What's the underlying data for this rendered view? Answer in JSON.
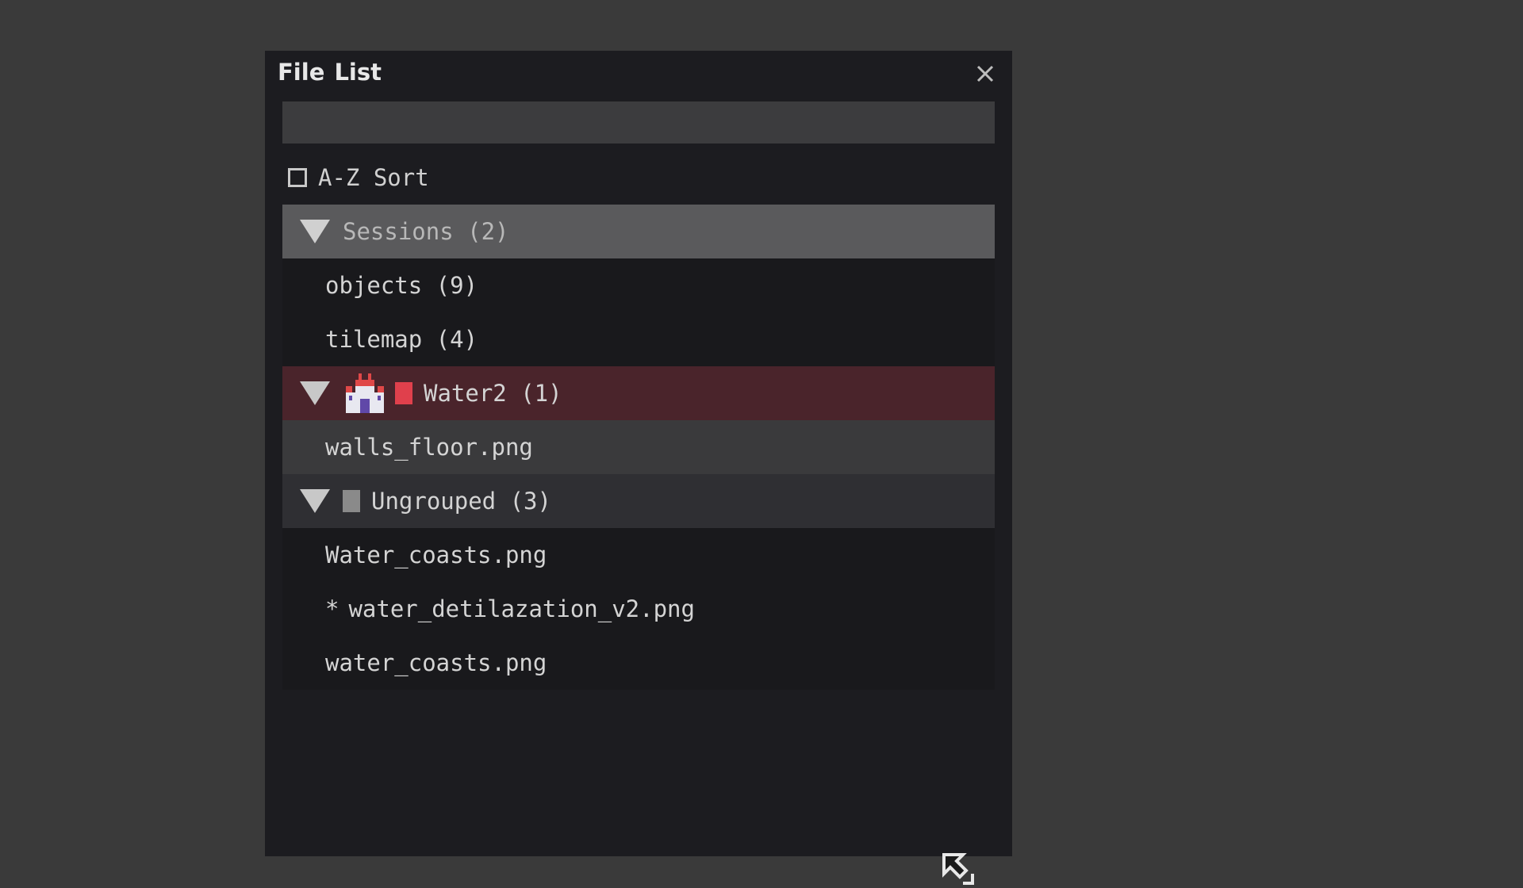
{
  "panel": {
    "title": "File List",
    "search": {
      "value": "",
      "placeholder": ""
    },
    "sort": {
      "label": "A-Z Sort",
      "checked": false
    }
  },
  "groups": {
    "sessions": {
      "label": "Sessions (2)",
      "items": [
        "objects (9)",
        "tilemap (4)"
      ]
    },
    "water2": {
      "label": "Water2 (1)",
      "color": "#e0404c",
      "items": [
        "walls_floor.png"
      ]
    },
    "ungrouped": {
      "label": "Ungrouped (3)",
      "color": "#8a8a8a",
      "items": [
        {
          "text": "Water_coasts.png",
          "modified": false
        },
        {
          "text": "water_detilazation_v2.png",
          "modified": true,
          "marker": "*"
        },
        {
          "text": "water_coasts.png",
          "modified": false
        }
      ]
    }
  },
  "colors": {
    "background": "#3a3a3a",
    "panel": "#1c1c20",
    "sessions_header": "#5a5a5c",
    "water2_header": "#4a242b",
    "selected_row": "#3a3a3c",
    "ungrouped_header": "#2f2f33"
  },
  "icons": {
    "close": "close-icon",
    "expand": "triangle-down-icon",
    "water2_thumb": "castle-icon",
    "cursor": "resize-cursor-icon"
  }
}
